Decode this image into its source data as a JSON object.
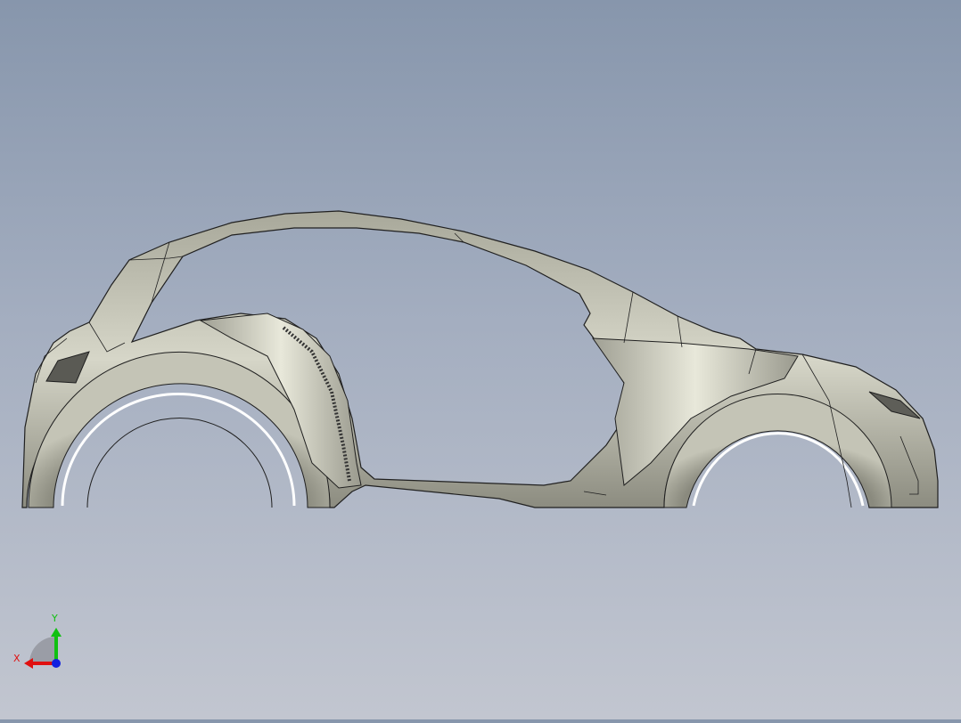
{
  "viewport": {
    "model": "car-body-side-view",
    "background_top": "#8796ac",
    "background_bottom": "#c2c6d0",
    "body_color": "#b8b8a8"
  },
  "triad": {
    "x_label": "X",
    "y_label": "Y",
    "x_color": "#e01010",
    "y_color": "#10c010",
    "z_color": "#1020e0"
  }
}
